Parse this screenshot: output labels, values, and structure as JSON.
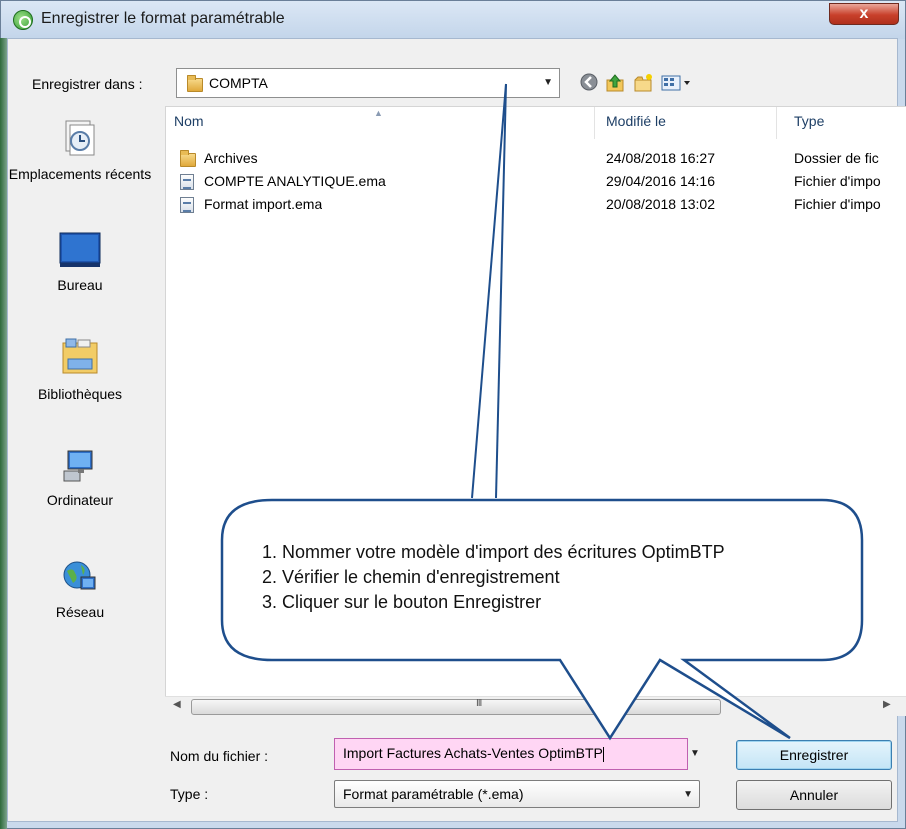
{
  "window": {
    "title": "Enregistrer le format paramétrable",
    "close_label": "x"
  },
  "toolbar": {
    "save_in_label": "Enregistrer dans :",
    "current_folder": "COMPTA",
    "icons": [
      "back-icon",
      "up-folder-icon",
      "new-folder-icon",
      "view-menu-icon"
    ]
  },
  "places": [
    {
      "label": "Emplacements récents",
      "icon": "recent-places-icon"
    },
    {
      "label": "Bureau",
      "icon": "desktop-icon"
    },
    {
      "label": "Bibliothèques",
      "icon": "libraries-icon"
    },
    {
      "label": "Ordinateur",
      "icon": "computer-icon"
    },
    {
      "label": "Réseau",
      "icon": "network-icon"
    }
  ],
  "file_list": {
    "columns": [
      "Nom",
      "Modifié le",
      "Type"
    ],
    "rows": [
      {
        "name": "Archives",
        "modified": "24/08/2018 16:27",
        "type": "Dossier de fic",
        "icon": "folder-icon"
      },
      {
        "name": "COMPTE ANALYTIQUE.ema",
        "modified": "29/04/2016 14:16",
        "type": "Fichier d'impo",
        "icon": "file-icon"
      },
      {
        "name": "Format import.ema",
        "modified": "20/08/2018 13:02",
        "type": "Fichier d'impo",
        "icon": "file-icon"
      }
    ],
    "scroll_grip": "III"
  },
  "form": {
    "filename_label": "Nom du fichier :",
    "filename_value": "Import Factures Achats-Ventes OptimBTP",
    "type_label": "Type :",
    "type_value": "Format paramétrable (*.ema)"
  },
  "buttons": {
    "save": "Enregistrer",
    "cancel": "Annuler"
  },
  "callout": {
    "lines": [
      "1. Nommer votre modèle d'import des écritures OptimBTP",
      "2. Vérifier le chemin d'enregistrement",
      "3. Cliquer sur le bouton Enregistrer"
    ]
  }
}
